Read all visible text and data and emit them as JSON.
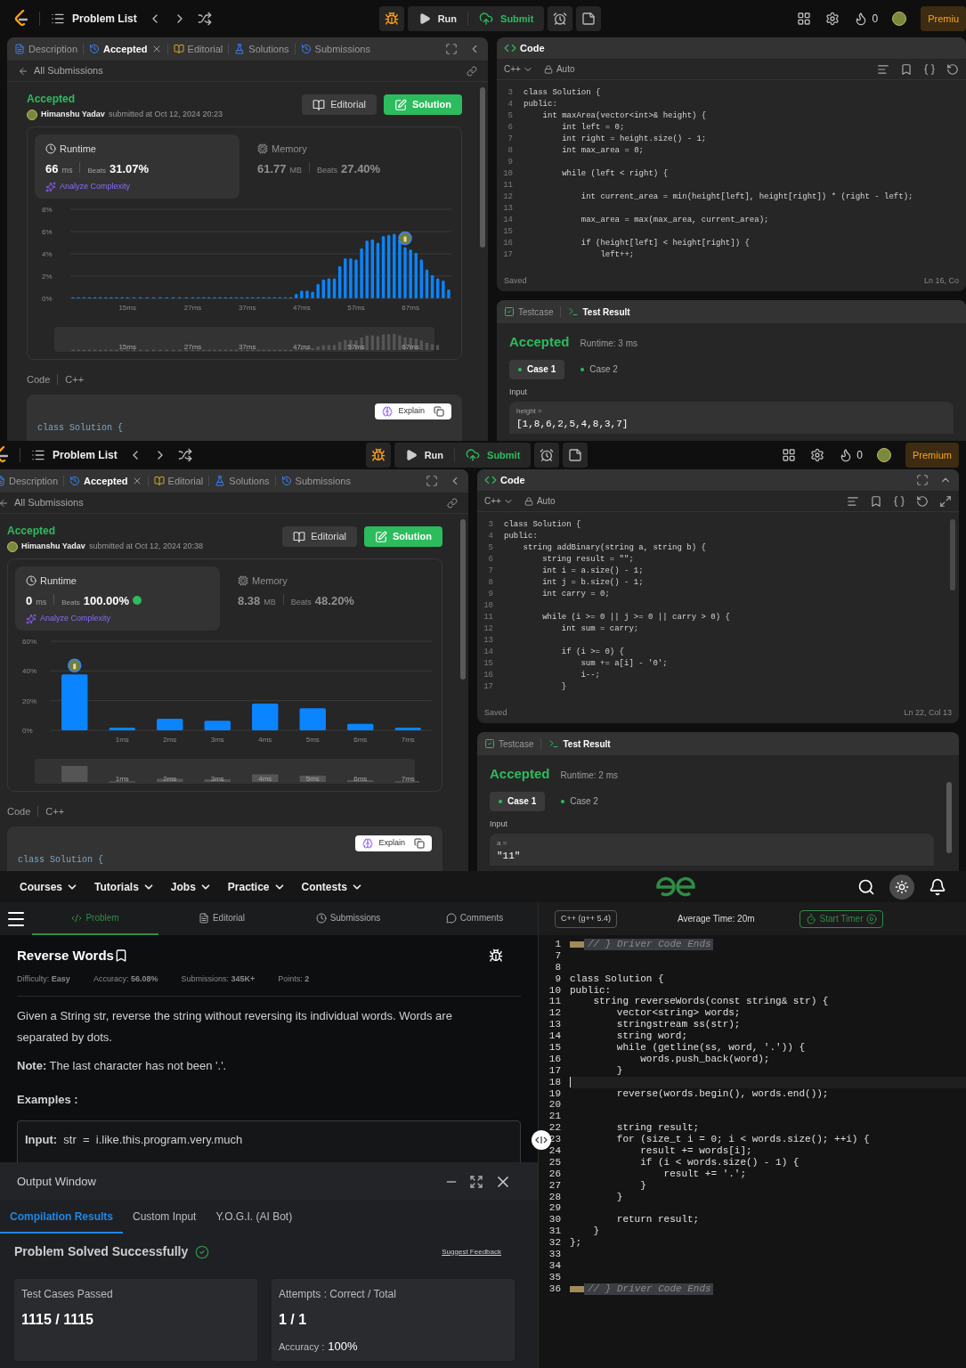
{
  "leetcode_windows": [
    {
      "right_edge_visible": false,
      "topbar": {
        "problem_list": "Problem List",
        "run": "Run",
        "submit": "Submit",
        "streak": "0",
        "premium": "Premiu"
      },
      "tabs": [
        {
          "label": "Description",
          "selected": false
        },
        {
          "label": "Accepted",
          "selected": true
        },
        {
          "label": "Editorial",
          "selected": false
        },
        {
          "label": "Solutions",
          "selected": false
        },
        {
          "label": "Submissions",
          "selected": false
        }
      ],
      "back_link": "All Submissions",
      "verdict": "Accepted",
      "author": "Himanshu Yadav",
      "submitted": "submitted at Oct 12, 2024 20:23",
      "editorial_button": "Editorial",
      "solution_button": "Solution",
      "runtime": {
        "label": "Runtime",
        "value": "66",
        "unit": "ms",
        "beats_label": "Beats",
        "beats": "31.07%",
        "top_badge": false,
        "analyze": "Analyze Complexity"
      },
      "memory": {
        "label": "Memory",
        "value": "61.77",
        "unit": "MB",
        "beats_label": "Beats",
        "beats": "27.40%"
      },
      "chart_data": {
        "type": "bar",
        "x": [
          5,
          6,
          7,
          8,
          9,
          10,
          11,
          12,
          13,
          14,
          15,
          16.2,
          17.4,
          18.6,
          19.8,
          21,
          22.2,
          23.4,
          24.6,
          25.8,
          27,
          28,
          29,
          30,
          31,
          32,
          33,
          34,
          35,
          36,
          37,
          38,
          39,
          40,
          41,
          42,
          43,
          44,
          45,
          46,
          47,
          48,
          49,
          50,
          51,
          52,
          53,
          54,
          55,
          56,
          57,
          58,
          59,
          60,
          61,
          62,
          63,
          64,
          65,
          66,
          67,
          68,
          69,
          70,
          71,
          72,
          73,
          74
        ],
        "xlim": [
          4.5,
          74.5
        ],
        "series": [
          {
            "color": "#0a84ff",
            "values": [
              0.1,
              0.1,
              0.1,
              0.1,
              0.1,
              0.1,
              0.1,
              0.1,
              0.1,
              0.1,
              0.1,
              0.1,
              0.1,
              0.1,
              0.1,
              0.1,
              0.1,
              0.1,
              0.1,
              0.1,
              0.1,
              0.1,
              0.1,
              0.1,
              0.1,
              0.1,
              0.1,
              0.1,
              0.1,
              0.1,
              0.1,
              0.1,
              0.1,
              0.1,
              0.1,
              0.1,
              0.1,
              0.1,
              0.1,
              0.4,
              0.7,
              0.7,
              0.6,
              1.3,
              1.7,
              1.8,
              1.8,
              2.9,
              3.6,
              3.6,
              3.5,
              4.5,
              5.2,
              5.3,
              5.0,
              5.6,
              5.7,
              5.8,
              5.3,
              4.6,
              4.4,
              4.1,
              3.5,
              2.6,
              2.1,
              1.8,
              1.6,
              0.8
            ]
          }
        ],
        "xticks": [
          {
            "value": 15,
            "label": "15ms"
          },
          {
            "value": 27,
            "label": "27ms"
          },
          {
            "value": 37,
            "label": "37ms"
          },
          {
            "value": 47,
            "label": "47ms"
          },
          {
            "value": 57,
            "label": "57ms"
          },
          {
            "value": 67,
            "label": "67ms"
          }
        ],
        "yticks": [
          {
            "value": 0,
            "label": "0%"
          },
          {
            "value": 2,
            "label": "2%"
          },
          {
            "value": 4,
            "label": "4%"
          },
          {
            "value": 6,
            "label": "6%"
          },
          {
            "value": 8,
            "label": "8%"
          }
        ],
        "ylim": [
          0,
          8
        ],
        "grid": true
      },
      "navigator_labels": [
        "15ms",
        "27ms",
        "37ms",
        "47ms",
        "57ms",
        "67ms"
      ],
      "code_label": "Code",
      "code_language": "C++",
      "explain": "Explain",
      "code_preview": "class Solution {",
      "editor": {
        "title": "Code",
        "language": "C++",
        "mode": "Auto",
        "status": "Saved",
        "cursor": "Ln 16, Co",
        "lines": [
          {
            "n": "3",
            "code": "class Solution {"
          },
          {
            "n": "4",
            "code": "public:"
          },
          {
            "n": "5",
            "code": "    int maxArea(vector<int>& height) {"
          },
          {
            "n": "6",
            "code": "        int left = 0;"
          },
          {
            "n": "7",
            "code": "        int right = height.size() - 1;"
          },
          {
            "n": "8",
            "code": "        int max_area = 0;"
          },
          {
            "n": "9"
          },
          {
            "n": "10",
            "code": "        while (left < right) {"
          },
          {
            "n": "11"
          },
          {
            "n": "12",
            "code": "            int current_area = min(height[left], height[right]) * (right - left);"
          },
          {
            "n": "13"
          },
          {
            "n": "14",
            "code": "            max_area = max(max_area, current_area);"
          },
          {
            "n": "15"
          },
          {
            "n": "16",
            "code": "            if (height[left] < height[right]) {"
          },
          {
            "n": "17",
            "code": "                left++;"
          }
        ]
      },
      "results": {
        "tabs": [
          {
            "label": "Testcase",
            "selected": false
          },
          {
            "label": "Test Result",
            "selected": true
          }
        ],
        "verdict": "Accepted",
        "runtime": "Runtime: 3 ms",
        "cases": [
          {
            "label": "Case 1",
            "selected": true
          },
          {
            "label": "Case 2",
            "selected": false
          }
        ],
        "input_label": "Input",
        "param": "height =",
        "value": "[1,8,6,2,5,4,8,3,7]"
      }
    },
    {
      "right_edge_visible": true,
      "topbar": {
        "problem_list": "Problem List",
        "run": "Run",
        "submit": "Submit",
        "streak": "0",
        "premium": "Premium"
      },
      "tabs": [
        {
          "label": "Description",
          "selected": false
        },
        {
          "label": "Accepted",
          "selected": true
        },
        {
          "label": "Editorial",
          "selected": false
        },
        {
          "label": "Solutions",
          "selected": false
        },
        {
          "label": "Submissions",
          "selected": false
        }
      ],
      "back_link": "All Submissions",
      "verdict": "Accepted",
      "author": "Himanshu Yadav",
      "submitted": "submitted at Oct 12, 2024 20:38",
      "editorial_button": "Editorial",
      "solution_button": "Solution",
      "runtime": {
        "label": "Runtime",
        "value": "0",
        "unit": "ms",
        "beats_label": "Beats",
        "beats": "100.00%",
        "top_badge": true,
        "analyze": "Analyze Complexity"
      },
      "memory": {
        "label": "Memory",
        "value": "8.38",
        "unit": "MB",
        "beats_label": "Beats",
        "beats": "48.20%"
      },
      "chart_data": {
        "type": "bar",
        "x": [
          0,
          1,
          2,
          3,
          4,
          5,
          6,
          7
        ],
        "xlim": [
          -0.5,
          7.5
        ],
        "series": [
          {
            "color": "#0a84ff",
            "values": [
              37.6,
              1.8,
              7.8,
              6.4,
              18,
              14.9,
              4.4,
              1.8
            ]
          }
        ],
        "xticks": [
          {
            "value": 1,
            "label": "1ms"
          },
          {
            "value": 2,
            "label": "2ms"
          },
          {
            "value": 3,
            "label": "3ms"
          },
          {
            "value": 4,
            "label": "4ms"
          },
          {
            "value": 5,
            "label": "5ms"
          },
          {
            "value": 6,
            "label": "6ms"
          },
          {
            "value": 7,
            "label": "7ms"
          }
        ],
        "yticks": [
          {
            "value": 0,
            "label": "0%"
          },
          {
            "value": 20,
            "label": "20%"
          },
          {
            "value": 40,
            "label": "40%"
          },
          {
            "value": 60,
            "label": "60%"
          }
        ],
        "ylim": [
          0,
          60
        ],
        "grid": true
      },
      "navigator_labels": [
        "1ms",
        "2ms",
        "3ms",
        "4ms",
        "5ms",
        "6ms",
        "7ms"
      ],
      "code_label": "Code",
      "code_language": "C++",
      "explain": "Explain",
      "code_preview": "class Solution {",
      "editor": {
        "title": "Code",
        "language": "C++",
        "mode": "Auto",
        "status": "Saved",
        "cursor": "Ln 22, Col 13",
        "lines": [
          {
            "n": "3",
            "code": "class Solution {"
          },
          {
            "n": "4",
            "code": "public:"
          },
          {
            "n": "5",
            "code": "    string addBinary(string a, string b) {"
          },
          {
            "n": "6",
            "code": "        string result = \"\";"
          },
          {
            "n": "7",
            "code": "        int i = a.size() - 1;"
          },
          {
            "n": "8",
            "code": "        int j = b.size() - 1;"
          },
          {
            "n": "9",
            "code": "        int carry = 0;"
          },
          {
            "n": "10"
          },
          {
            "n": "11",
            "code": "        while (i >= 0 || j >= 0 || carry > 0) {"
          },
          {
            "n": "12",
            "code": "            int sum = carry;"
          },
          {
            "n": "13"
          },
          {
            "n": "14",
            "code": "            if (i >= 0) {"
          },
          {
            "n": "15",
            "code": "                sum += a[i] - '0';"
          },
          {
            "n": "16",
            "code": "                i--;"
          },
          {
            "n": "17",
            "code": "            }"
          }
        ]
      },
      "results": {
        "tabs": [
          {
            "label": "Testcase",
            "selected": false
          },
          {
            "label": "Test Result",
            "selected": true
          }
        ],
        "verdict": "Accepted",
        "runtime": "Runtime: 2 ms",
        "cases": [
          {
            "label": "Case 1",
            "selected": true
          },
          {
            "label": "Case 2",
            "selected": false
          }
        ],
        "input_label": "Input",
        "param": "a =",
        "value": "\"11\""
      }
    }
  ],
  "gfg": {
    "nav": [
      "Courses",
      "Tutorials",
      "Jobs",
      "Practice",
      "Contests"
    ],
    "tabs": [
      {
        "label": "Problem",
        "selected": true
      },
      {
        "label": "Editorial",
        "selected": false
      },
      {
        "label": "Submissions",
        "selected": false
      },
      {
        "label": "Comments",
        "selected": false
      }
    ],
    "title": "Reverse Words",
    "meta": [
      "Difficulty: **Easy**",
      "Accuracy: **56.08%**",
      "Submissions: **345K+**",
      "Points: **2**"
    ],
    "description": "Given a String str, reverse the string without reversing its individual words. Words are separated by dots.",
    "note": "**Note:** The last character has not been '.'.",
    "examples_heading": "Examples :",
    "example_input": "**Input:**  str  =  i.like.this.program.very.much",
    "output_window": {
      "title": "Output Window",
      "tabs": [
        {
          "label": "Compilation Results",
          "selected": true
        },
        {
          "label": "Custom Input",
          "selected": false
        },
        {
          "label": "Y.O.G.I. (AI Bot)",
          "selected": false
        }
      ],
      "status": "Problem Solved Successfully",
      "feedback": "Suggest Feedback",
      "passed_label": "Test Cases Passed",
      "passed": "1115 / 1115",
      "attempts_label": "Attempts : Correct / Total",
      "attempts": "1 / 1",
      "accuracy_label": "Accuracy :",
      "accuracy": "100%"
    },
    "editor": {
      "language": "C++ (g++ 5.4)",
      "average_time": "Average Time: 20m",
      "timer_button": "Start Timer",
      "lines": [
        {
          "n": "1",
          "kind": "folded",
          "current": false,
          "code": "// } Driver Code Ends"
        },
        {
          "n": "7",
          "kind": "code",
          "current": false
        },
        {
          "n": "8",
          "kind": "code",
          "current": false
        },
        {
          "n": "9",
          "kind": "code",
          "current": false,
          "code": "class Solution {"
        },
        {
          "n": "10",
          "kind": "code",
          "current": false,
          "code": "public:"
        },
        {
          "n": "11",
          "kind": "code",
          "current": false,
          "code": "    string reverseWords(const string& str) {"
        },
        {
          "n": "12",
          "kind": "code",
          "current": false,
          "code": "        vector<string> words;"
        },
        {
          "n": "13",
          "kind": "code",
          "current": false,
          "code": "        stringstream ss(str);"
        },
        {
          "n": "14",
          "kind": "code",
          "current": false,
          "code": "        string word;"
        },
        {
          "n": "15",
          "kind": "code",
          "current": false,
          "code": "        while (getline(ss, word, '.')) {"
        },
        {
          "n": "16",
          "kind": "code",
          "current": false,
          "code": "            words.push_back(word);"
        },
        {
          "n": "17",
          "kind": "code",
          "current": false,
          "code": "        }"
        },
        {
          "n": "18",
          "kind": "code",
          "current": true
        },
        {
          "n": "19",
          "kind": "code",
          "current": false,
          "code": "        reverse(words.begin(), words.end());"
        },
        {
          "n": "20",
          "kind": "code",
          "current": false
        },
        {
          "n": "21",
          "kind": "code",
          "current": false
        },
        {
          "n": "22",
          "kind": "code",
          "current": false,
          "code": "        string result;"
        },
        {
          "n": "23",
          "kind": "code",
          "current": false,
          "code": "        for (size_t i = 0; i < words.size(); ++i) {"
        },
        {
          "n": "24",
          "kind": "code",
          "current": false,
          "code": "            result += words[i];"
        },
        {
          "n": "25",
          "kind": "code",
          "current": false,
          "code": "            if (i < words.size() - 1) {"
        },
        {
          "n": "26",
          "kind": "code",
          "current": false,
          "code": "                result += '.';"
        },
        {
          "n": "27",
          "kind": "code",
          "current": false,
          "code": "            }"
        },
        {
          "n": "28",
          "kind": "code",
          "current": false,
          "code": "        }"
        },
        {
          "n": "29",
          "kind": "code",
          "current": false
        },
        {
          "n": "30",
          "kind": "code",
          "current": false,
          "code": "        return result;"
        },
        {
          "n": "31",
          "kind": "code",
          "current": false,
          "code": "    }"
        },
        {
          "n": "32",
          "kind": "code",
          "current": false,
          "code": "};"
        },
        {
          "n": "33",
          "kind": "code",
          "current": false
        },
        {
          "n": "34",
          "kind": "code",
          "current": false
        },
        {
          "n": "35",
          "kind": "code",
          "current": false
        },
        {
          "n": "36",
          "kind": "folded",
          "current": false,
          "code": "// } Driver Code Ends"
        }
      ]
    }
  }
}
